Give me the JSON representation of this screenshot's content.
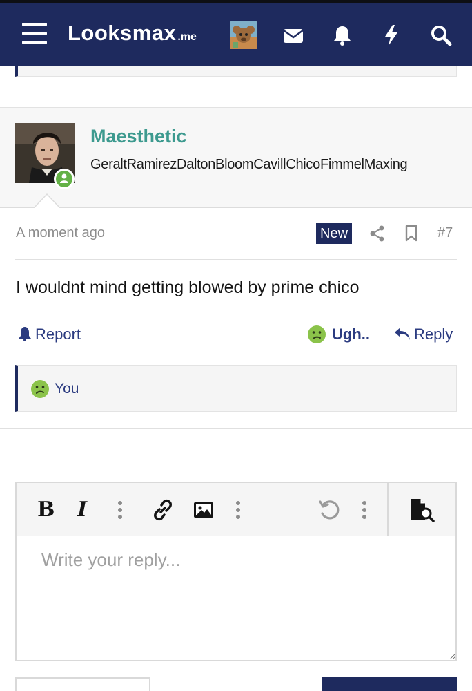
{
  "header": {
    "logo_main": "Lᴏᴏksmax",
    "logo_tld": ".me",
    "icons": [
      "menu-icon",
      "user-avatar",
      "envelope-icon",
      "bell-icon",
      "bolt-icon",
      "search-icon"
    ],
    "brand_color": "#1e2a5e"
  },
  "post": {
    "username": "Maesthetic",
    "user_title": "GeraltRamirezDaltonBloomCavillChicoFimmelMaxing",
    "online": true,
    "date": "A moment ago",
    "badge": "New",
    "number": "#7",
    "body": "I wouldnt mind getting blowed by prime chico",
    "actions": {
      "report": "Report",
      "reaction": "Ugh..",
      "reply": "Reply"
    },
    "reactions_summary": "You",
    "username_color": "#3d9a8f"
  },
  "editor": {
    "placeholder": "Write your reply...",
    "toolbar": [
      "bold-icon",
      "italic-icon",
      "more-vertical-icon",
      "link-icon",
      "image-icon",
      "more-vertical-icon",
      "undo-icon",
      "more-vertical-icon",
      "preview-icon"
    ]
  }
}
